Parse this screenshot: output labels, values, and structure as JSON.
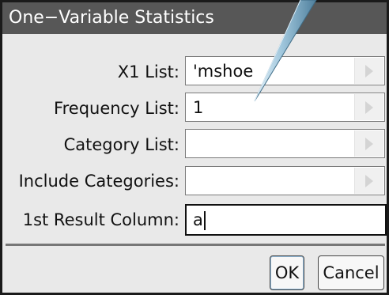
{
  "dialog": {
    "title": "One−Variable Statistics"
  },
  "fields": {
    "x1_list": {
      "label": "X1 List:",
      "value": "'mshoe"
    },
    "frequency_list": {
      "label": "Frequency List:",
      "value": "1"
    },
    "category_list": {
      "label": "Category List:",
      "value": ""
    },
    "include_categories": {
      "label": "Include Categories:",
      "value": ""
    },
    "first_result_column": {
      "label": "1st Result Column:",
      "value": "a"
    }
  },
  "buttons": {
    "ok_label": "OK",
    "cancel_label": "Cancel"
  },
  "icons": {
    "combo_arrow": "triangle-right-icon",
    "pointer": "pen-pointer-icon"
  },
  "colors": {
    "title_bar": "#575757",
    "dialog_background": "#e9e9e9",
    "field_background": "#ffffff"
  }
}
